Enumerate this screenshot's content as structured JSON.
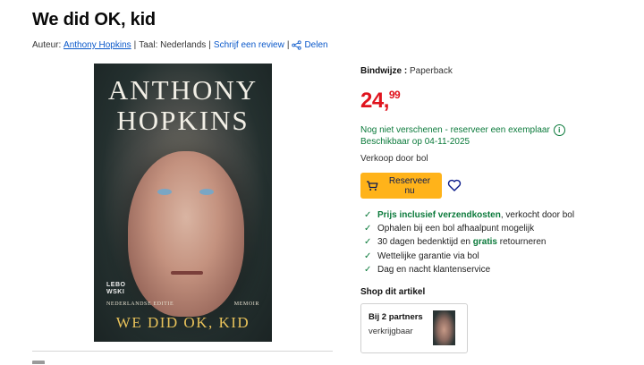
{
  "product": {
    "title": "We did OK, kid",
    "author_label": "Auteur:",
    "author": "Anthony Hopkins",
    "language_label": "Taal: Nederlands",
    "review_link": "Schrijf een review",
    "share_label": "Delen"
  },
  "cover": {
    "line1": "ANTHONY",
    "line2": "HOPKINS",
    "publisher_line1": "LEBO",
    "publisher_line2": "WSKI",
    "edition": "NEDERLANDSE EDITIE",
    "genre": "MEMOIR",
    "subtitle": "WE DID OK, KID"
  },
  "purchase": {
    "binding_label": "Bindwijze :",
    "binding_value": "Paperback",
    "price_main": "24,",
    "price_cents": "99",
    "availability": "Nog niet verschenen - reserveer een exemplaar",
    "available_date": "Beschikbaar op 04-11-2025",
    "seller": "Verkoop door bol",
    "reserve_button": "Reserveer nu",
    "accent_color": "#ffb31a",
    "price_color": "#e0141e"
  },
  "usps": [
    {
      "bold": "Prijs inclusief verzendkosten",
      "rest": ", verkocht door bol"
    },
    {
      "pre": "Ophalen bij een bol afhaalpunt mogelijk"
    },
    {
      "pre": "30 dagen bedenktijd en ",
      "bold": "gratis",
      "rest": " retourneren"
    },
    {
      "pre": "Wettelijke garantie via bol"
    },
    {
      "pre": "Dag en nacht klantenservice"
    }
  ],
  "shop": {
    "heading": "Shop dit artikel",
    "partners_title": "Bij 2 partners",
    "partners_sub": "verkrijgbaar"
  }
}
